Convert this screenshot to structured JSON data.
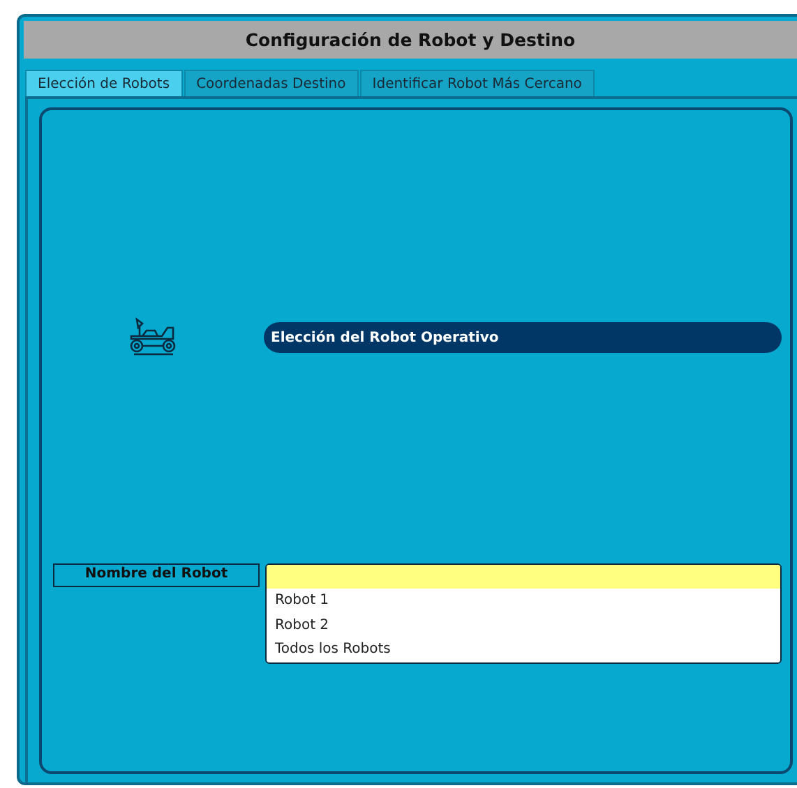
{
  "window": {
    "title": "Configuración de Robot y Destino"
  },
  "tabs": [
    {
      "label": "Elección de Robots",
      "selected": true
    },
    {
      "label": "Coordenadas Destino",
      "selected": false
    },
    {
      "label": "Identificar Robot Más Cercano",
      "selected": false
    }
  ],
  "section_header": "Elección del Robot Operativo",
  "robot_name": {
    "label": "Nombre del Robot",
    "options": [
      "Robot 1",
      "Robot 2",
      "Todos los Robots"
    ]
  }
}
